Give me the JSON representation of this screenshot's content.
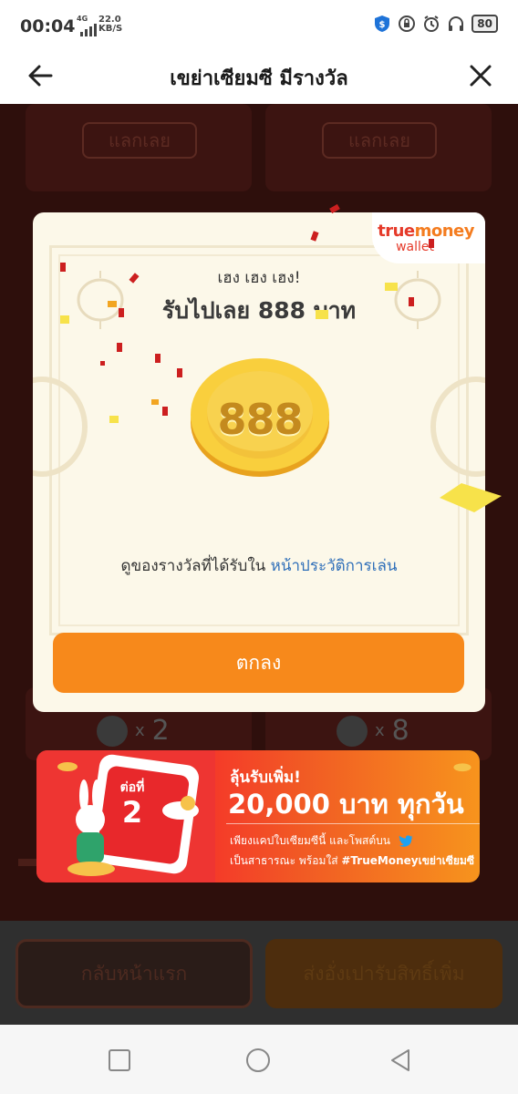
{
  "status_bar": {
    "time": "00:04",
    "network": "4G",
    "speed_value": "22.0",
    "speed_unit": "KB/S",
    "battery": "80"
  },
  "header": {
    "title": "เขย่าเซียมซี มีรางวัล",
    "back_icon": "arrow-left-icon",
    "close_icon": "close-icon"
  },
  "background_cards": {
    "redeem_label": "แลกเลย",
    "counts": [
      "2",
      "8"
    ],
    "times": "x"
  },
  "modal": {
    "brand_true": "true",
    "brand_money": "money",
    "brand_wallet": "wallet",
    "subtitle": "เฮง เฮง เฮง!",
    "title": "รับไปเลย 888 บาท",
    "coin_value": "888",
    "history_text": "ดูของรางวัลที่ได้รับใน",
    "history_link": "หน้าประวัติการเล่น",
    "ok_button": "ตกลง"
  },
  "banner": {
    "order_label": "ต่อที่",
    "order_number": "2",
    "line1": "ลุ้นรับเพิ่ม!",
    "line2": "20,000 บาท ทุกวัน",
    "line3": "เพียงแคปใบเซียมซีนี้ และโพสต์บน",
    "line4_prefix": "เป็นสาธารณะ พร้อมใส่",
    "line4_hashtag": "#TrueMoneyเขย่าเซียมซี"
  },
  "bottom_buttons": {
    "home": "กลับหน้าแรก",
    "send": "ส่งอั่งเปารับสิทธิ์เพิ่ม"
  },
  "colors": {
    "accent_orange": "#f7891b",
    "link_blue": "#2f6fb9",
    "bg_dark": "#2e0f0c",
    "modal_bg": "#fcf8e9"
  }
}
